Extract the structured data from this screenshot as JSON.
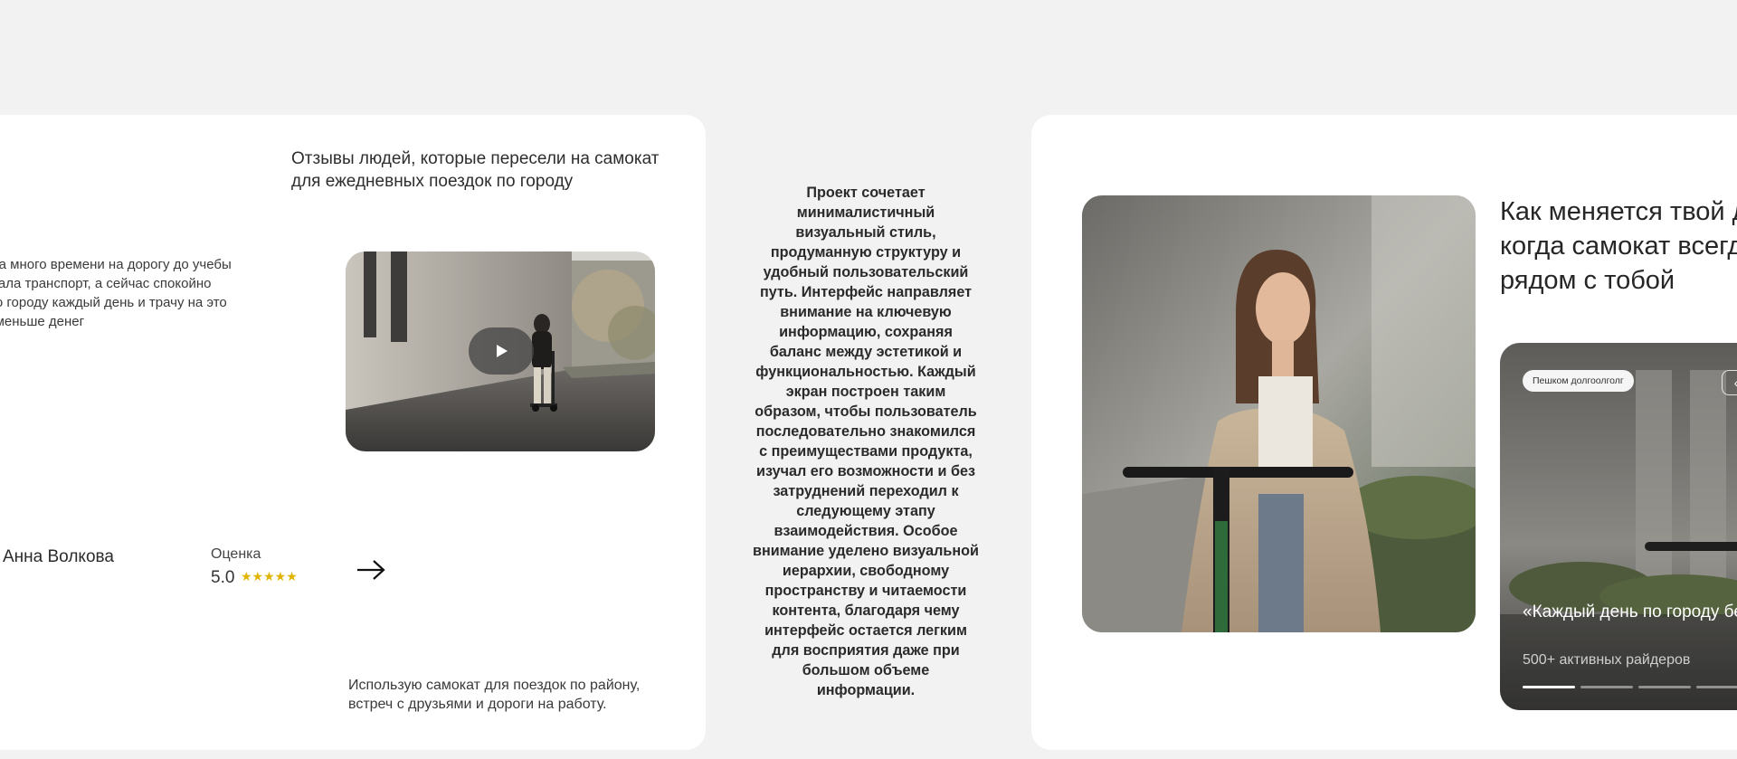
{
  "reviews": {
    "heading": "Отзывы людей, которые пересели на самокат для ежедневных поездок по городу",
    "review_text": "Тратила много времени на дорогу до учебы и ожидала транспорт, а сейчас спокойно езжу по городу каждый день и трачу на это много меньше денег",
    "reviewer_name": "Анна Волкова",
    "rating_label": "Оценка",
    "rating_value": "5.0",
    "stars": "★★★★★",
    "next_icon": "arrow-right-icon",
    "review_text_2": "Использую самокат для поездок по району, встреч с друзьями и дороги на работу.",
    "play_icon": "play-icon"
  },
  "middle": {
    "text": "Проект сочетает минималистичный визуальный стиль, продуманную структуру и удобный пользовательский путь. Интерфейс направляет внимание на ключевую информацию, сохраняя баланс между эстетикой и функциональностью. Каждый экран построен таким образом, чтобы пользователь последовательно знакомился с преимуществами продукта, изучал его возможности и без затруднений переходил к следующему этапу взаимодействия. Особое внимание уделено визуальной иерархии, свободному пространству и читаемости контента, благодаря чему интерфейс остается легким для восприятия даже при большом объеме информации."
  },
  "feature": {
    "heading": "Как меняется твой день, когда самокат всегда рядом с тобой",
    "slider": {
      "badge": "Пешком долгоолголг",
      "control_icon": "chevron-left-icon",
      "quote": "«Каждый день по городу без ожиданий и пересадок»",
      "subtitle": "500+ активных райдеров",
      "progress_active": 1,
      "progress_total": 4
    }
  },
  "colors": {
    "background": "#f2f2f2",
    "card": "#ffffff",
    "star": "#e0b400"
  }
}
